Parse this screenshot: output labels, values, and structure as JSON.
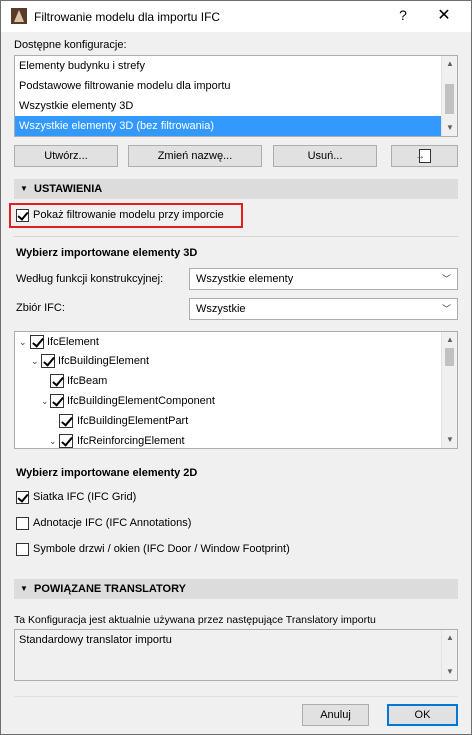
{
  "window": {
    "title": "Filtrowanie modelu dla importu IFC",
    "help": "?",
    "close": "✕"
  },
  "configs": {
    "label": "Dostępne konfiguracje:",
    "items": [
      {
        "label": "Elementy budynku i strefy",
        "selected": false
      },
      {
        "label": "Podstawowe filtrowanie modelu dla importu",
        "selected": false
      },
      {
        "label": "Wszystkie elementy 3D",
        "selected": false
      },
      {
        "label": "Wszystkie elementy 3D (bez filtrowania)",
        "selected": true
      }
    ],
    "buttons": {
      "create": "Utwórz...",
      "rename": "Zmień nazwę...",
      "delete": "Usuń..."
    }
  },
  "settings": {
    "header": "USTAWIENIA",
    "show_filter_label": "Pokaż filtrowanie modelu przy imporcie",
    "show_filter_checked": true,
    "elements3d_title": "Wybierz importowane elementy 3D",
    "by_function_label": "Według funkcji konstrukcyjnej:",
    "by_function_value": "Wszystkie elementy",
    "ifc_set_label": "Zbiór IFC:",
    "ifc_set_value": "Wszystkie",
    "tree": [
      {
        "label": "IfcElement",
        "checked": true,
        "expanded": true
      },
      {
        "label": "IfcBuildingElement",
        "checked": true,
        "expanded": true
      },
      {
        "label": "IfcBeam",
        "checked": true,
        "expanded": null
      },
      {
        "label": "IfcBuildingElementComponent",
        "checked": true,
        "expanded": true
      },
      {
        "label": "IfcBuildingElementPart",
        "checked": true,
        "expanded": null
      },
      {
        "label": "IfcReinforcingElement",
        "checked": true,
        "expanded": true
      }
    ],
    "elements2d_title": "Wybierz importowane elementy 2D",
    "options2d": [
      {
        "label": "Siatka IFC (IFC Grid)",
        "checked": true
      },
      {
        "label": "Adnotacje IFC (IFC Annotations)",
        "checked": false
      },
      {
        "label": "Symbole drzwi / okien (IFC Door / Window Footprint)",
        "checked": false
      }
    ]
  },
  "translators": {
    "header": "POWIĄZANE TRANSLATORY",
    "info": "Ta Konfiguracja jest aktualnie używana przez następujące Translatory importu",
    "list": "Standardowy translator importu"
  },
  "footer": {
    "cancel": "Anuluj",
    "ok": "OK"
  },
  "icons": {
    "app": "archicad-icon",
    "import": "import-file-icon",
    "collapse": "triangle-down-icon",
    "dropdown": "chevron-down-icon"
  }
}
